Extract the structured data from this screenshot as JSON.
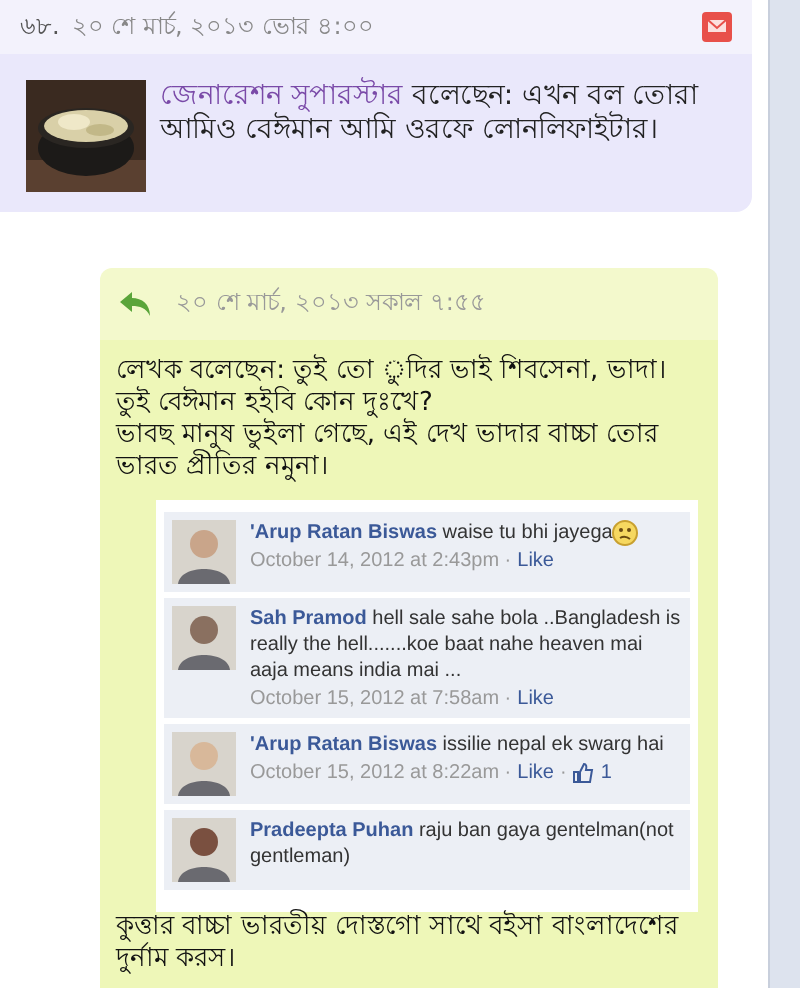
{
  "post": {
    "number": "৬৮.",
    "date": "২০ শে মার্চ, ২০১৩ ভোর ৪:০০",
    "author": "জেনারেশন সুপারস্টার",
    "text": "বলেছেন: এখন বল তোরা আমিও বেঈমান আমি ওরফে লোনলিফাইটার।"
  },
  "reply": {
    "date": "২০ শে মার্চ, ২০১৩ সকাল ৭:৫৫",
    "paragraphs": [
      "লেখক বলেছেন: তুই তো ুদির ভাই শিবসেনা, ভাদা। তুই বেঈমান হইবি কোন দুঃখে?",
      "ভাবছ মানুষ ভুইলা গেছে, এই দেখ ভাদার বাচ্চা তোর ভারত প্রীতির নমুনা।"
    ],
    "embed": {
      "comments": [
        {
          "name": "'Arup Ratan Biswas",
          "text": "waise tu bhi jayega",
          "emoji": true,
          "time": "October 14, 2012 at 2:43pm ·",
          "like": "Like"
        },
        {
          "name": "Sah Pramod",
          "text": "hell sale sahe bola ..Bangladesh is really the hell.......koe baat nahe heaven mai aaja means india mai ...",
          "emoji": false,
          "time": "October 15, 2012 at 7:58am ·",
          "like": "Like"
        },
        {
          "name": "'Arup Ratan Biswas",
          "text": "issilie nepal ek swarg hai",
          "emoji": false,
          "time": "October 15, 2012 at 8:22am ·",
          "like": "Like",
          "likes": {
            "sep": "·",
            "count": "1"
          }
        },
        {
          "name": "Pradeepta Puhan",
          "text": "raju ban gaya gentelman(not gentleman)",
          "emoji": false
        }
      ]
    },
    "after": "কুত্তার বাচ্চা ভারতীয় দোস্তগো সাথে বইসা বাংলাদেশের দুর্নাম করস।"
  }
}
